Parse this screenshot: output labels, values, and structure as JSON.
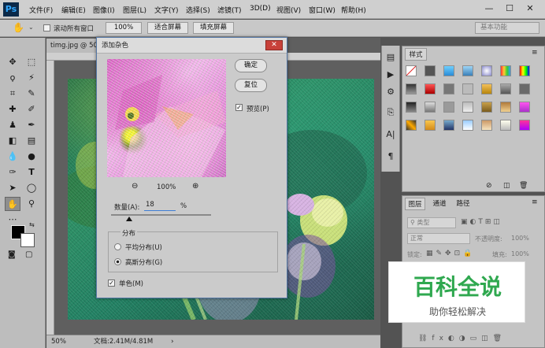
{
  "app": {
    "logo": "Ps"
  },
  "menubar": {
    "items": [
      "文件(F)",
      "编辑(E)",
      "图像(I)",
      "图层(L)",
      "文字(Y)",
      "选择(S)",
      "滤镜(T)",
      "3D(D)",
      "视图(V)",
      "窗口(W)",
      "帮助(H)"
    ],
    "window_controls": [
      "—",
      "☐",
      "✕"
    ]
  },
  "options_bar": {
    "hand_icon": "hand-icon",
    "scroll_all_windows": "滚动所有窗口",
    "zoom_100": "100%",
    "fit_screen": "适合屏幕",
    "fill_screen": "填充屏幕",
    "workspace": "基本功能"
  },
  "document": {
    "tab_title": "timg.jpg @ 50",
    "status_zoom": "50%",
    "status_doc": "文档:2.41M/4.81M"
  },
  "dialog": {
    "title": "添加杂色",
    "ok": "确定",
    "reset": "复位",
    "preview_label": "预览(P)",
    "preview_checked": true,
    "zoom_value": "100%",
    "amount_label": "数量(A):",
    "amount_value": "18",
    "amount_unit": "%",
    "amount_slider_fraction": 0.18,
    "distribution_title": "分布",
    "uniform": "平均分布(U)",
    "gaussian": "高斯分布(G)",
    "gaussian_selected": true,
    "monochrome": "单色(M)",
    "monochrome_checked": true
  },
  "styles_panel": {
    "tab": "样式"
  },
  "layers_panel": {
    "tabs": [
      "图层",
      "通道",
      "路径"
    ],
    "filter_kind": "类型",
    "blend_mode": "正常",
    "opacity_label": "不透明度:",
    "opacity_value": "100%",
    "lock_label": "锁定:",
    "fill_label": "填充:",
    "fill_value": "100%"
  },
  "watermark": {
    "title": "百科全说",
    "subtitle": "助你轻松解决",
    "title_color": "#2fa84f"
  }
}
